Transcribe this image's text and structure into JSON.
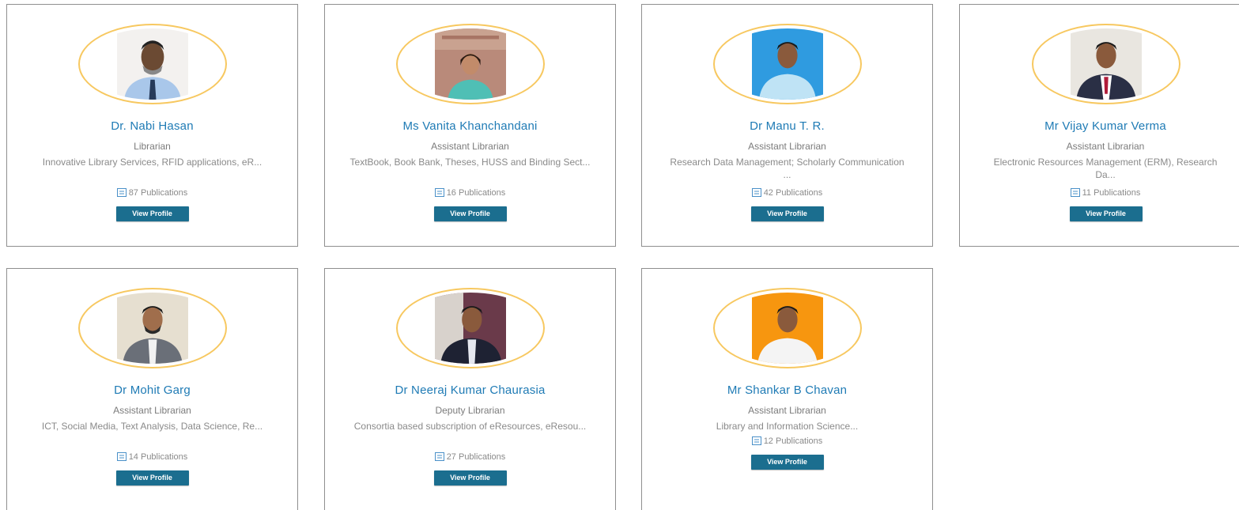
{
  "staff": [
    {
      "name": "Dr. Nabi Hasan",
      "role": "Librarian",
      "interests": "Innovative Library Services, RFID applications, eR...",
      "publications": "87 Publications",
      "button": "View Profile",
      "avatar_bg": "#f3f1ef"
    },
    {
      "name": "Ms Vanita Khanchandani",
      "role": "Assistant Librarian",
      "interests": "TextBook, Book Bank, Theses, HUSS and Binding Sect...",
      "publications": "16 Publications",
      "button": "View Profile",
      "avatar_bg": "#b98a7a"
    },
    {
      "name": "Dr Manu T. R.",
      "role": "Assistant Librarian",
      "interests": "Research Data Management; Scholarly Communication ...",
      "publications": "42 Publications",
      "button": "View Profile",
      "avatar_bg": "#2f9be0"
    },
    {
      "name": "Mr Vijay Kumar Verma",
      "role": "Assistant Librarian",
      "interests": "Electronic Resources Management (ERM), Research Da...",
      "publications": "11 Publications",
      "button": "View Profile",
      "avatar_bg": "#e9e6e0"
    },
    {
      "name": "Dr Mohit Garg",
      "role": "Assistant Librarian",
      "interests": "ICT, Social Media, Text Analysis, Data Science, Re...",
      "publications": "14 Publications",
      "button": "View Profile",
      "avatar_bg": "#e6dfd0"
    },
    {
      "name": "Dr Neeraj Kumar Chaurasia",
      "role": "Deputy Librarian",
      "interests": "Consortia based subscription of eResources, eResou...",
      "publications": "27 Publications",
      "button": "View Profile",
      "avatar_bg": "#6a3a4a"
    },
    {
      "name": "Mr Shankar B Chavan",
      "role": "Assistant Librarian",
      "interests": "Library and Information Science...",
      "publications": "12 Publications",
      "button": "View Profile",
      "avatar_bg": "#f7960f"
    }
  ],
  "colors": {
    "name": "#1f7bb5",
    "button": "#1b6e8f",
    "avatar_ring": "#f7c860",
    "border": "#8f8f8f"
  },
  "icons": {
    "publications": "document-icon"
  }
}
